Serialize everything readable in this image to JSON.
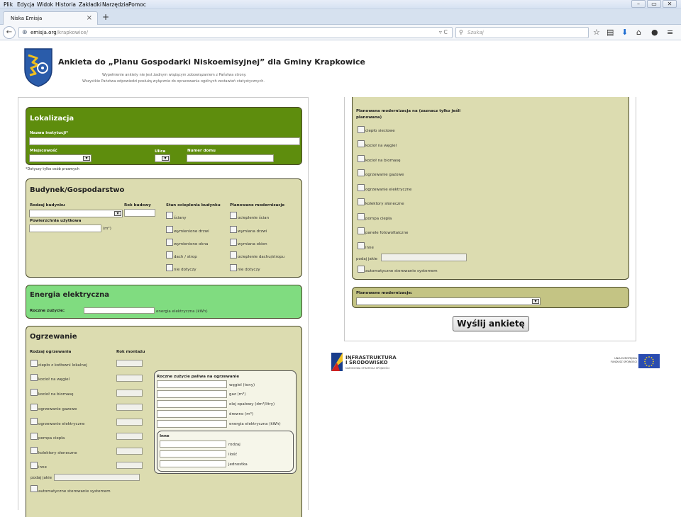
{
  "browser": {
    "menu": [
      "Plik",
      "Edycja",
      "Widok",
      "Historia",
      "Zakładki",
      "Narzędzia",
      "Pomoc"
    ],
    "tab_title": "Niska Emisja",
    "url_host": "emisja.org",
    "url_path": "/krapkowice/",
    "search_placeholder": "Szukaj"
  },
  "header": {
    "title": "Ankieta do „Planu Gospodarki Niskoemisyjnej” dla Gminy Krapkowice",
    "subtitle1": "Wypełnienie ankiety nie jest żadnym wiążącym zobowiązaniem z Państwa strony.",
    "subtitle2": "Wszystkie Państwa odpowiedzi posłużą wyłącznie do opracowania ogólnych zestawień statystycznych."
  },
  "lokalizacja": {
    "title": "Lokalizacja",
    "nazwa_label": "Nazwa instytucji*",
    "miejscowosc_label": "Miejscowość",
    "ulica_label": "Ulica",
    "numer_label": "Numer domu",
    "note": "*Dotyczy tylko osób prawnych"
  },
  "budynek": {
    "title": "Budynek/Gospodarstwo",
    "rodzaj_label": "Rodzaj budynku",
    "rok_label": "Rok budowy",
    "pow_label": "Powierzchnia użytkowa",
    "pow_unit": "(m²)",
    "stan_header": "Stan ocieplenia budynku",
    "stan_items": [
      "ściany",
      "wymienione drzwi",
      "wymienione okna",
      "dach / strop",
      "nie dotyczy"
    ],
    "plan_header": "Planowane modernizacje",
    "plan_items": [
      "ocieplenie ścian",
      "wymiana drzwi",
      "wymiana okien",
      "ocieplenie dachu/stropu",
      "nie dotyczy"
    ]
  },
  "energia": {
    "title": "Energia elektryczna",
    "label": "Roczne zużycie:",
    "unit": "energia elektryczna (kWh)"
  },
  "ogrzewanie": {
    "title": "Ogrzewanie",
    "rodzaj_header": "Rodzaj ogrzewania",
    "rok_header": "Rok montażu",
    "items": [
      "ciepło z kotłowni lokalnej",
      "kocioł na węgiel",
      "kocioł na biomasę",
      "ogrzewanie gazowe",
      "ogrzewanie elektryczne",
      "pompa ciepła",
      "kolektory słoneczne",
      "inne"
    ],
    "podaj_label": "podaj jakie",
    "auto_label": "automatyczne sterowanie systemem",
    "paliwo_header": "Roczne zużycie paliwa na ogrzewanie",
    "paliwo_units": [
      "węgiel (tony)",
      "gaz (m³)",
      "olej opałowy (dm³/litry)",
      "drewno (m³)",
      "energia elektryczna (kWh)"
    ],
    "inne_header": "Inne",
    "inne_units": [
      "rodzaj",
      "ilość",
      "jednostka"
    ]
  },
  "modernizacja": {
    "header_line1": "Planowana modernizacja na (zaznacz tylko jeśli",
    "header_line2": "planowana)",
    "items": [
      "ciepło sieciowe",
      "kocioł na węgiel",
      "kocioł na biomasę",
      "ogrzewanie gazowe",
      "ogrzewanie elektryczne",
      "kolektory słoneczne",
      "pompa ciepła",
      "panele fotowoltaiczne",
      "inne"
    ],
    "podaj_label": "podaj jakie",
    "auto_label": "automatyczne sterowanie systemem"
  },
  "planowane": {
    "title": "Planowane modernizacje:"
  },
  "submit_label": "Wyślij ankietę",
  "logos": {
    "is_line1": "INFRASTRUKTURA",
    "is_line2": "I ŚRODOWISKO",
    "is_line3": "NARODOWA STRATEGIA SPÓJNOŚCI",
    "eu_line1": "UNIA EUROPEJSKA",
    "eu_line2": "FUNDUSZ SPÓJNOŚCI"
  },
  "colors": {
    "lokalizacja": "#5e8d0d",
    "budynek": "#dcdcb0",
    "energia": "#80dc80",
    "planowane": "#c4c484"
  }
}
